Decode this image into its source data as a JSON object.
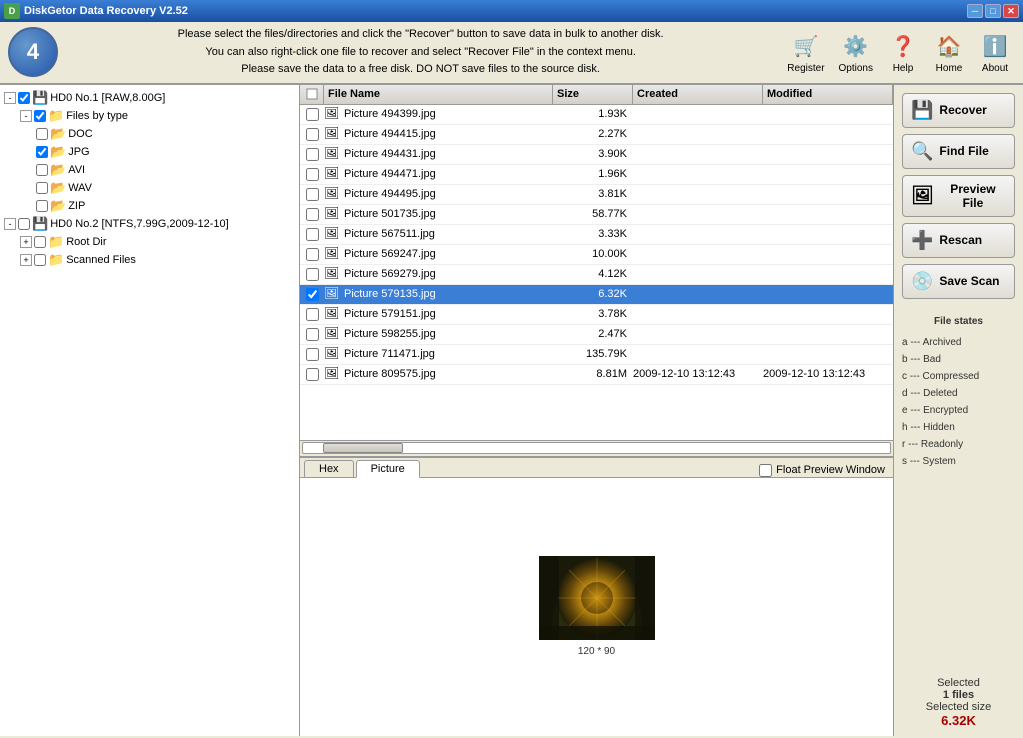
{
  "window": {
    "title": "DiskGetor Data Recovery V2.52",
    "min_btn": "─",
    "max_btn": "□",
    "close_btn": "✕"
  },
  "toolbar": {
    "step_number": "4",
    "instruction_line1": "Please select the files/directories and click the \"Recover\" button to save data in bulk to another disk.",
    "instruction_line2": "You can also right-click one file to recover and select \"Recover File\" in the context menu.",
    "instruction_line3": "Please save the data to a free disk. DO NOT save files to the source disk.",
    "buttons": [
      {
        "id": "register",
        "label": "Register",
        "icon": "🛒"
      },
      {
        "id": "options",
        "label": "Options",
        "icon": "⚙️"
      },
      {
        "id": "help",
        "label": "Help",
        "icon": "❓"
      },
      {
        "id": "home",
        "label": "Home",
        "icon": "🏠"
      },
      {
        "id": "about",
        "label": "About",
        "icon": "ℹ️"
      }
    ]
  },
  "tree": {
    "items": [
      {
        "label": "HD0 No.1 [RAW,8.00G]",
        "level": 0,
        "checked": true,
        "expanded": true,
        "type": "hdd"
      },
      {
        "label": "Files by type",
        "level": 1,
        "checked": true,
        "expanded": true,
        "type": "folder"
      },
      {
        "label": "DOC",
        "level": 2,
        "checked": false,
        "type": "folder"
      },
      {
        "label": "JPG",
        "level": 2,
        "checked": true,
        "type": "folder"
      },
      {
        "label": "AVI",
        "level": 2,
        "checked": false,
        "type": "folder"
      },
      {
        "label": "WAV",
        "level": 2,
        "checked": false,
        "type": "folder"
      },
      {
        "label": "ZIP",
        "level": 2,
        "checked": false,
        "type": "folder"
      },
      {
        "label": "HD0 No.2 [NTFS,7.99G,2009-12-10]",
        "level": 0,
        "checked": false,
        "expanded": true,
        "type": "hdd"
      },
      {
        "label": "Root Dir",
        "level": 1,
        "checked": false,
        "expanded": false,
        "type": "folder"
      },
      {
        "label": "Scanned Files",
        "level": 1,
        "checked": false,
        "expanded": false,
        "type": "folder"
      }
    ]
  },
  "file_list": {
    "columns": [
      "",
      "File Name",
      "Size",
      "Created",
      "Modified"
    ],
    "rows": [
      {
        "checked": false,
        "name": "Picture 494399.jpg",
        "size": "1.93K",
        "created": "",
        "modified": ""
      },
      {
        "checked": false,
        "name": "Picture 494415.jpg",
        "size": "2.27K",
        "created": "",
        "modified": ""
      },
      {
        "checked": false,
        "name": "Picture 494431.jpg",
        "size": "3.90K",
        "created": "",
        "modified": ""
      },
      {
        "checked": false,
        "name": "Picture 494471.jpg",
        "size": "1.96K",
        "created": "",
        "modified": ""
      },
      {
        "checked": false,
        "name": "Picture 494495.jpg",
        "size": "3.81K",
        "created": "",
        "modified": ""
      },
      {
        "checked": false,
        "name": "Picture 501735.jpg",
        "size": "58.77K",
        "created": "",
        "modified": ""
      },
      {
        "checked": false,
        "name": "Picture 567511.jpg",
        "size": "3.33K",
        "created": "",
        "modified": ""
      },
      {
        "checked": false,
        "name": "Picture 569247.jpg",
        "size": "10.00K",
        "created": "",
        "modified": ""
      },
      {
        "checked": false,
        "name": "Picture 569279.jpg",
        "size": "4.12K",
        "created": "",
        "modified": ""
      },
      {
        "checked": true,
        "name": "Picture 579135.jpg",
        "size": "6.32K",
        "created": "",
        "modified": "",
        "selected": true
      },
      {
        "checked": false,
        "name": "Picture 579151.jpg",
        "size": "3.78K",
        "created": "",
        "modified": ""
      },
      {
        "checked": false,
        "name": "Picture 598255.jpg",
        "size": "2.47K",
        "created": "",
        "modified": ""
      },
      {
        "checked": false,
        "name": "Picture 711471.jpg",
        "size": "135.79K",
        "created": "",
        "modified": ""
      },
      {
        "checked": false,
        "name": "Picture 809575.jpg",
        "size": "8.81M",
        "created": "2009-12-10 13:12:43",
        "modified": "2009-12-10 13:12:43"
      }
    ]
  },
  "preview_tabs": [
    {
      "id": "hex",
      "label": "Hex"
    },
    {
      "id": "picture",
      "label": "Picture"
    }
  ],
  "preview": {
    "active_tab": "picture",
    "float_checkbox_label": "Float Preview Window",
    "image_size": "120 * 90"
  },
  "actions": {
    "recover_label": "Recover",
    "find_file_label": "Find File",
    "preview_file_label": "Preview File",
    "rescan_label": "Rescan",
    "save_scan_label": "Save Scan"
  },
  "file_states": {
    "title": "File states",
    "states": [
      {
        "key": "a",
        "desc": "Archived"
      },
      {
        "key": "b",
        "desc": "Bad"
      },
      {
        "key": "c",
        "desc": "Compressed"
      },
      {
        "key": "d",
        "desc": "Deleted"
      },
      {
        "key": "e",
        "desc": "Encrypted"
      },
      {
        "key": "h",
        "desc": "Hidden"
      },
      {
        "key": "r",
        "desc": "Readonly"
      },
      {
        "key": "s",
        "desc": "System"
      }
    ]
  },
  "selected_info": {
    "label": "Selected",
    "count_label": "1 files",
    "size_label_prefix": "Selected size",
    "size_value": "6.32K"
  },
  "colors": {
    "titlebar_start": "#3a7fd5",
    "titlebar_end": "#1a4fa0",
    "selected_row": "#3a7fd5",
    "accent_red": "#aa0000"
  }
}
